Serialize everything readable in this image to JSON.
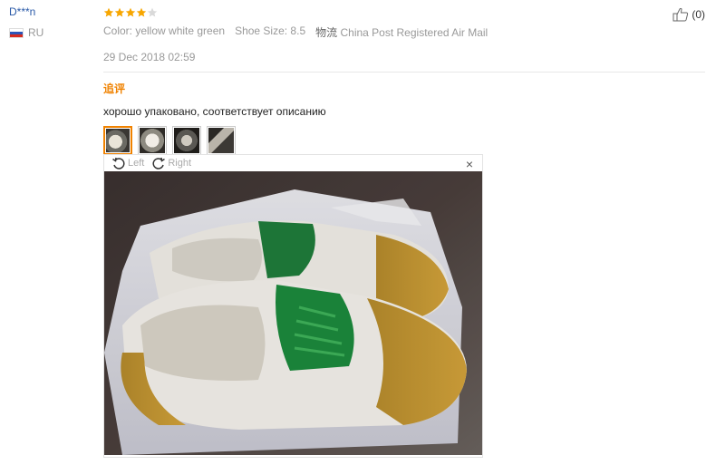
{
  "reviewer": {
    "name": "D***n",
    "country": "RU"
  },
  "review": {
    "rating": 4,
    "max_rating": 5,
    "color_label": "Color: yellow white green",
    "size_label": "Shoe Size: 8.5",
    "shipping_prefix": "物流",
    "shipping_label": "China Post Registered Air Mail",
    "date": "29 Dec 2018 02:59"
  },
  "helpful": {
    "count": "(0)"
  },
  "followup": {
    "title": "追评",
    "text": "хорошо упаковано, соответствует описанию"
  },
  "viewer": {
    "rotate_left_label": "Left",
    "rotate_right_label": "Right",
    "close_symbol": "×"
  },
  "icons": {
    "star": "star-icon",
    "thumb": "thumbs-up-icon",
    "rotate_left": "rotate-left-icon",
    "rotate_right": "rotate-right-icon",
    "close": "close-icon"
  },
  "colors": {
    "star_on": "#f7a600",
    "star_off": "#d9d9d9",
    "accent": "#f08200",
    "username": "#2b5aa8"
  }
}
